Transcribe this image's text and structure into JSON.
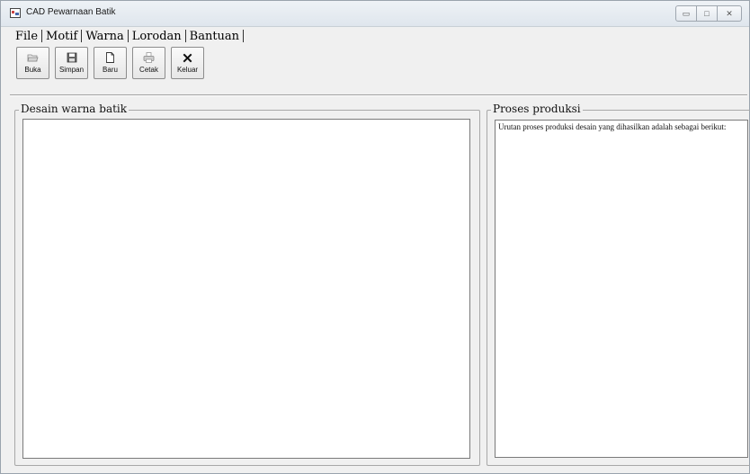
{
  "window": {
    "title": "CAD Pewarnaan Batik",
    "controls": {
      "minimize": "▭",
      "maximize": "□",
      "close": "✕"
    }
  },
  "menu": {
    "items": [
      {
        "label": "File"
      },
      {
        "label": "Motif"
      },
      {
        "label": "Warna"
      },
      {
        "label": "Lorodan"
      },
      {
        "label": "Bantuan"
      }
    ]
  },
  "toolbar": {
    "buttons": [
      {
        "label": "Buka",
        "icon": "open-folder-icon"
      },
      {
        "label": "Simpan",
        "icon": "save-disk-icon"
      },
      {
        "label": "Baru",
        "icon": "new-file-icon"
      },
      {
        "label": "Cetak",
        "icon": "printer-icon"
      },
      {
        "label": "Keluar",
        "icon": "close-x-icon"
      }
    ]
  },
  "design_panel": {
    "title": "Desain warna batik"
  },
  "process_panel": {
    "title": "Proses produksi",
    "text": "Urutan proses produksi desain yang dihasilkan adalah sebagai berikut:"
  }
}
